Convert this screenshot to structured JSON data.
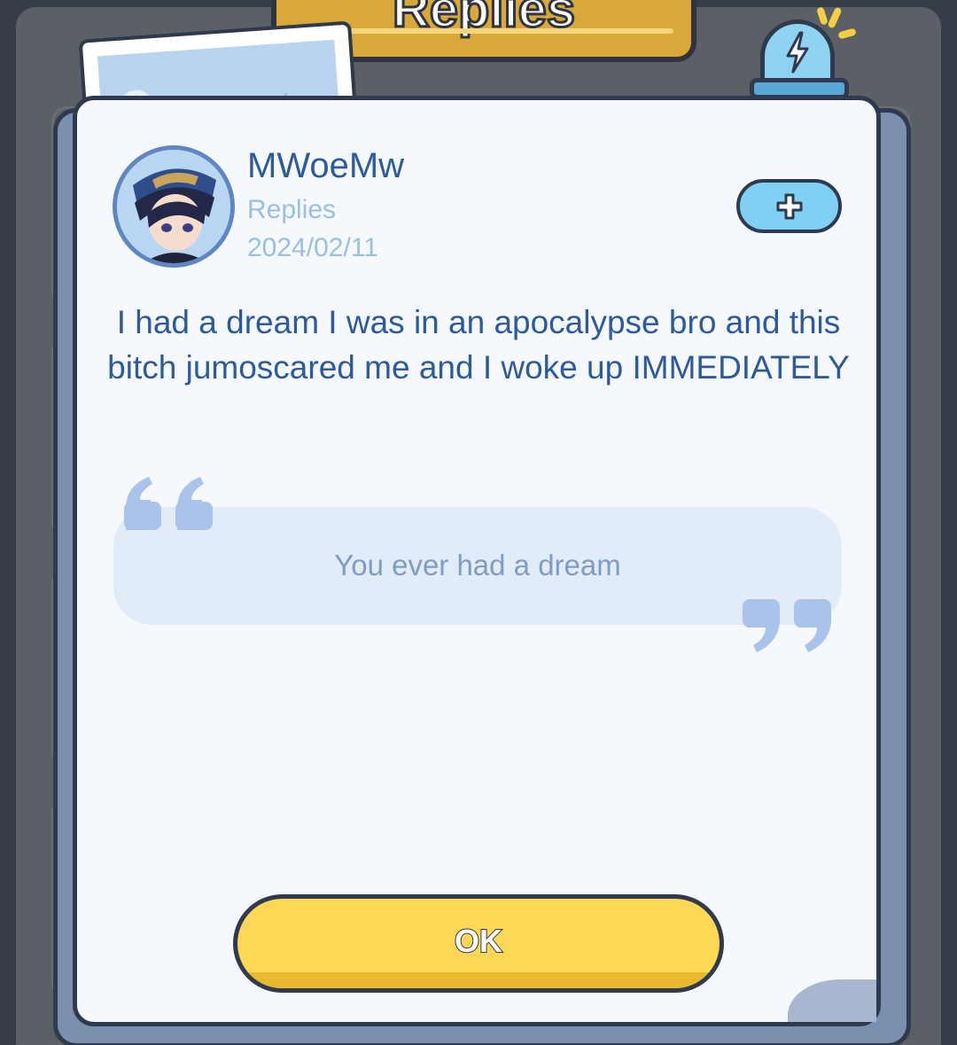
{
  "header": {
    "title": "Replies"
  },
  "post": {
    "username": "MWoeMw",
    "reply_type": "Replies",
    "date": "2024/02/11",
    "message": "I had a dream I was in an apocalypse bro and this bitch jumoscared me and I woke up IMMEDIATELY",
    "quoted_text": "You ever had a dream"
  },
  "actions": {
    "add_icon": "plus-icon",
    "ok_label": "OK"
  },
  "icons": {
    "siren": "siren-lightning-icon",
    "quote_open": "quote-open-icon",
    "quote_close": "quote-close-icon"
  },
  "colors": {
    "primary_text": "#2d5a9a",
    "secondary_text": "#9bbde0",
    "accent_blue": "#7fd0f2",
    "ok_yellow": "#ffd757",
    "card_bg": "#f5f9fe",
    "outline": "#2f3a4e"
  }
}
